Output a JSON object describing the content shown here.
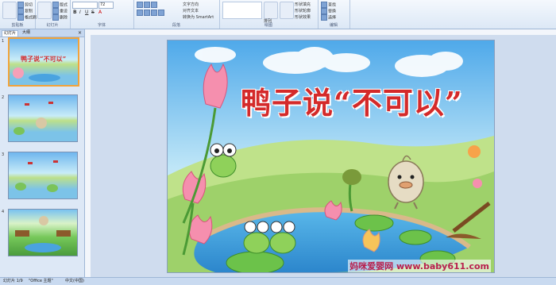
{
  "ribbon": {
    "groups": [
      {
        "label": "剪贴板"
      },
      {
        "label": "幻灯片"
      },
      {
        "label": "字体"
      },
      {
        "label": "段落"
      },
      {
        "label": "绘图"
      },
      {
        "label": "编辑"
      }
    ],
    "clipboard": {
      "paste": "粘贴",
      "cut": "剪切",
      "copy": "复制",
      "format_painter": "格式刷"
    },
    "slides": {
      "new_slide": "新建幻灯片",
      "layout": "版式",
      "reset": "重设",
      "delete": "删除"
    },
    "font": {
      "size": "72"
    },
    "paragraph": {
      "text_direction": "文字方向",
      "align_text": "对齐文本",
      "smartart": "转换为 SmartArt"
    },
    "drawing": {
      "arrange": "排列",
      "quick_styles": "快速样式",
      "fill": "形状填充",
      "outline": "形状轮廓",
      "effects": "形状效果"
    },
    "editing": {
      "find": "查找",
      "replace": "替换",
      "select": "选择"
    }
  },
  "panel": {
    "tabs": [
      "幻灯片",
      "大纲"
    ],
    "slides": [
      {
        "num": "1",
        "title": "鸭子说“不可以”"
      },
      {
        "num": "2"
      },
      {
        "num": "3"
      },
      {
        "num": "4"
      }
    ]
  },
  "slide": {
    "title": "鸭子说“不可以”"
  },
  "status": {
    "slide_info": "幻灯片 1/9",
    "theme": "\"Office 主题\"",
    "language": "中文(中国)"
  },
  "watermark": "妈咪爱婴网 www.baby611.com"
}
